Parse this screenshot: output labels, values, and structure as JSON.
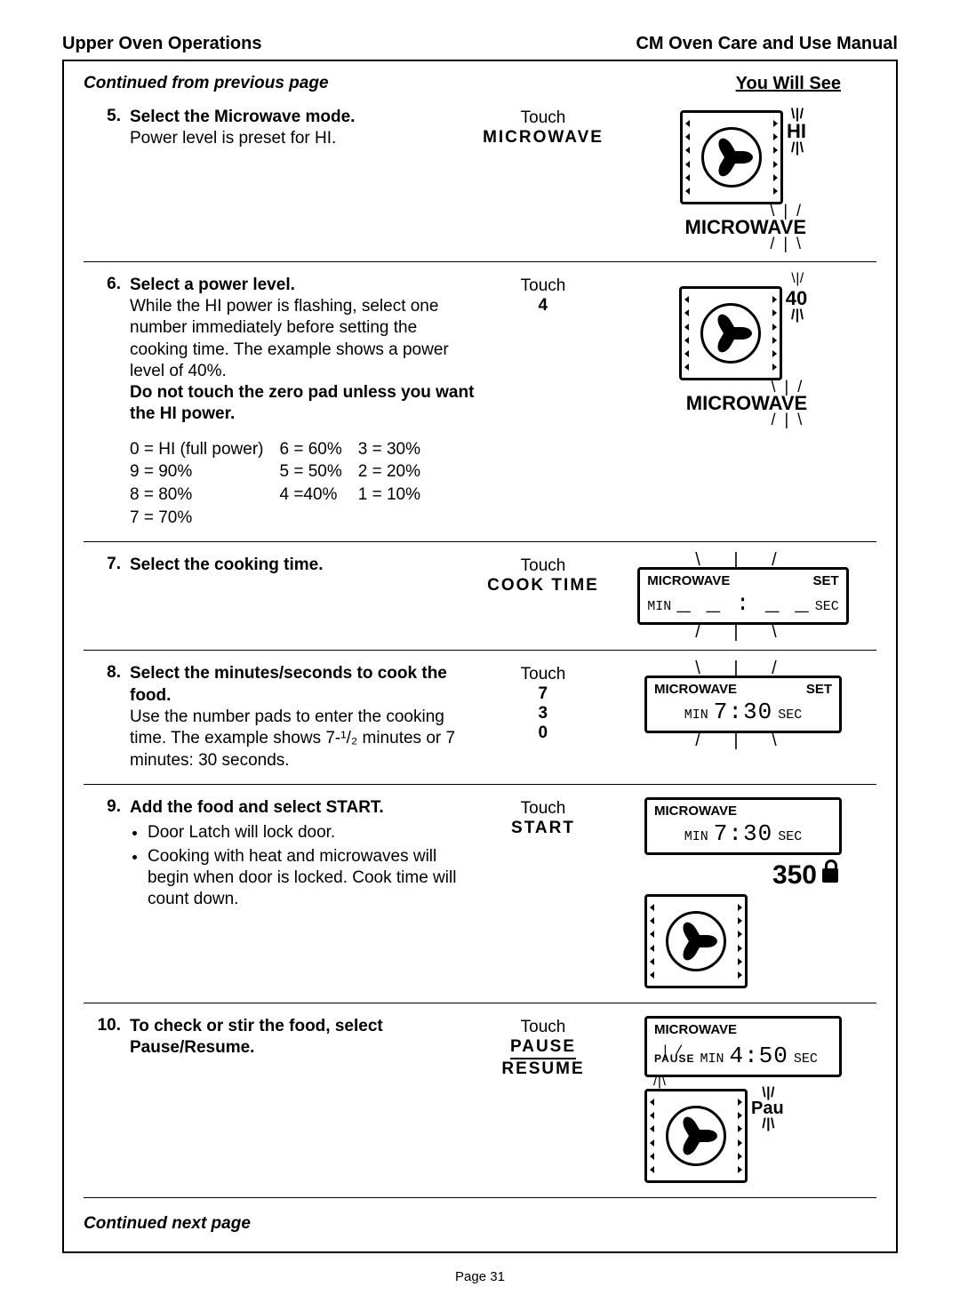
{
  "header": {
    "left": "Upper Oven Operations",
    "right": "CM Oven Care and Use Manual"
  },
  "continued_top": "Continued from previous page",
  "you_will_see": "You Will See",
  "steps": [
    {
      "num": "5.",
      "title": "Select the Microwave mode.",
      "desc": "Power level is preset for HI.",
      "touch_label": "Touch",
      "touch_value": "MICROWAVE",
      "display": {
        "side_value": "HI",
        "mode": "MICROWAVE"
      }
    },
    {
      "num": "6.",
      "title": "Select a power level.",
      "desc": "While the HI power is flashing, select one number immediately before setting the cooking time. The example shows a power level of 40%.",
      "note": "Do not touch the zero pad unless you want the HI power.",
      "touch_label": "Touch",
      "touch_value": "4",
      "display": {
        "side_value": "40",
        "mode": "MICROWAVE"
      },
      "power_cols": [
        [
          "0 = HI (full power)",
          "9 = 90%",
          "8 = 80%",
          "7 = 70%"
        ],
        [
          "6 = 60%",
          "5 = 50%",
          "4 =40%"
        ],
        [
          "3 = 30%",
          "2 = 20%",
          "1 = 10%"
        ]
      ]
    },
    {
      "num": "7.",
      "title": "Select the cooking time.",
      "touch_label": "Touch",
      "touch_value": "COOK TIME",
      "display": {
        "lcd_top_left": "MICROWAVE",
        "lcd_top_right": "SET",
        "lcd_min_label": "MIN",
        "lcd_time": "_ _ : _ _",
        "lcd_sec_label": "SEC"
      }
    },
    {
      "num": "8.",
      "title": "Select the minutes/seconds to cook the food.",
      "desc_html": "Use the number pads to enter the cooking time. The example shows 7‑¹/₂ minutes or 7 minutes: 30 seconds.",
      "touch_label": "Touch",
      "touch_values": [
        "7",
        "3",
        "0"
      ],
      "display": {
        "lcd_top_left": "MICROWAVE",
        "lcd_top_right": "SET",
        "lcd_min_label": "MIN",
        "lcd_time": "7:30",
        "lcd_sec_label": "SEC"
      }
    },
    {
      "num": "9.",
      "title": "Add the food and select START.",
      "bullets": [
        "Door Latch will lock door.",
        "Cooking with heat and microwaves will begin when door is locked. Cook time will count down."
      ],
      "touch_label": "Touch",
      "touch_value": "START",
      "display": {
        "lcd_top_left": "MICROWAVE",
        "lcd_min_label": "MIN",
        "lcd_time": "7:30",
        "lcd_sec_label": "SEC",
        "temp": "350"
      }
    },
    {
      "num": "10.",
      "title": "To check or stir the food, select Pause/Resume.",
      "touch_label": "Touch",
      "touch_value1": "PAUSE",
      "touch_value2": "RESUME",
      "display": {
        "lcd_top_left": "MICROWAVE",
        "pause_label": "PAUSE",
        "lcd_min_label": "MIN",
        "lcd_time": "4:50",
        "lcd_sec_label": "SEC",
        "pau": "Pau"
      }
    }
  ],
  "continued_bottom": "Continued next page",
  "page_number": "Page 31"
}
